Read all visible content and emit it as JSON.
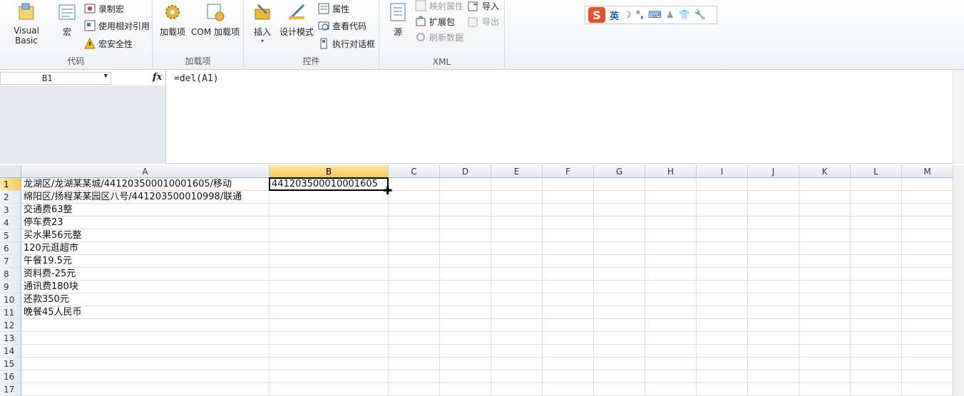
{
  "ribbon": {
    "groups": {
      "code": {
        "label": "代码",
        "visual_basic": "Visual Basic",
        "macro": "宏",
        "record_macro": "录制宏",
        "relative_ref": "使用相对引用",
        "macro_security": "宏安全性"
      },
      "addins": {
        "label": "加载项",
        "addins": "加载项",
        "com_addins": "COM 加载项"
      },
      "controls": {
        "label": "控件",
        "insert": "插入",
        "design_mode": "设计模式",
        "properties": "属性",
        "view_code": "查看代码",
        "run_dialog": "执行对话框"
      },
      "xml": {
        "label": "XML",
        "source": "源",
        "map_props": "映射属性",
        "import": "导入",
        "expansion_pack": "扩展包",
        "export": "导出",
        "refresh": "刷新数据"
      }
    },
    "ime": {
      "mode": "英"
    }
  },
  "formula_bar": {
    "name_box": "B1",
    "fx": "fx",
    "formula": "=del(A1)"
  },
  "sheet": {
    "columns": [
      "A",
      "B",
      "C",
      "D",
      "E",
      "F",
      "G",
      "H",
      "I",
      "J",
      "K",
      "L",
      "M"
    ],
    "rows": [
      "1",
      "2",
      "3",
      "4",
      "5",
      "6",
      "7",
      "8",
      "9",
      "10",
      "11",
      "12",
      "13",
      "14",
      "15",
      "16",
      "17"
    ],
    "active_cell": "B1",
    "cells": {
      "A1": "龙湖区/龙湖某某城/441203500010001605/移动",
      "A2": "绵阳区/扬程某某园区八号/441203500010998/联通",
      "A3": "交通费63整",
      "A4": "停车费23",
      "A5": "买水果56元整",
      "A6": "120元逛超市",
      "A7": "午餐19.5元",
      "A8": "资料费-25元",
      "A9": "通讯费180块",
      "A10": "还款350元",
      "A11": "晚餐45人民币",
      "B1": "441203500010001605"
    }
  }
}
